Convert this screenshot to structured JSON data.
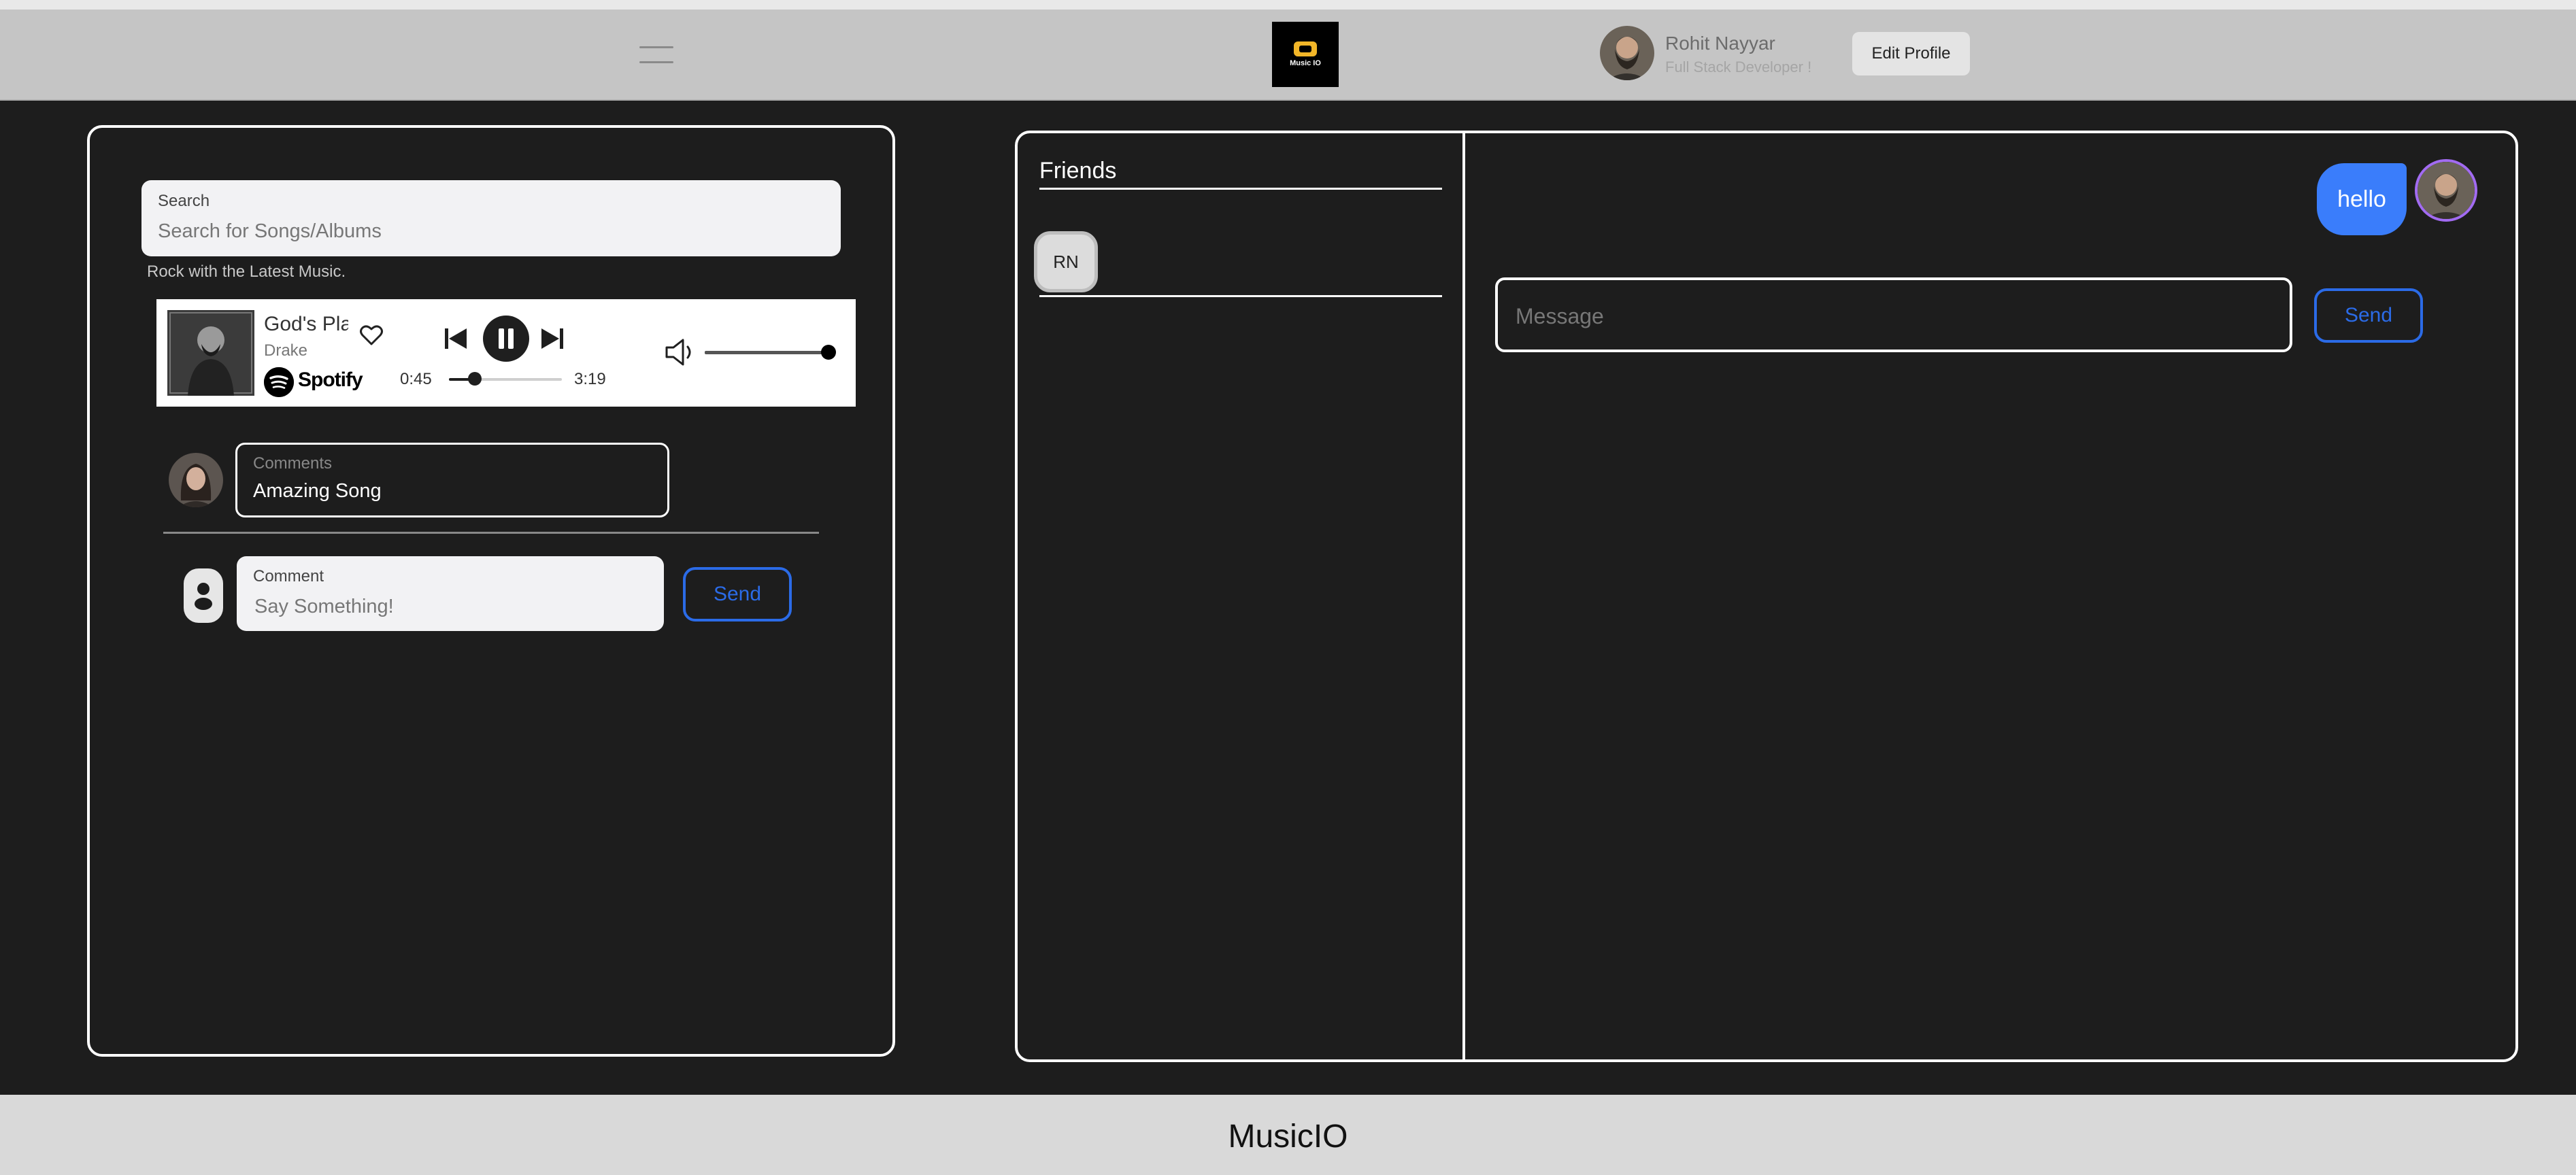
{
  "header": {
    "logo_text": "Music IO",
    "user_name": "Rohit Nayyar",
    "user_role": "Full Stack Developer !",
    "edit_profile_label": "Edit Profile"
  },
  "left": {
    "search": {
      "label": "Search",
      "placeholder": "Search for Songs/Albums"
    },
    "tagline": "Rock with the Latest Music.",
    "player": {
      "title": "God's Plan",
      "artist": "Drake",
      "brand": "Spotify",
      "current_time": "0:45",
      "total_time": "3:19",
      "progress": 0.23,
      "volume": 1.0
    },
    "comment": {
      "label": "Comments",
      "text": "Amazing Song"
    },
    "new_comment": {
      "label": "Comment",
      "placeholder": "Say Something!",
      "send_label": "Send"
    }
  },
  "right": {
    "friends_title": "Friends",
    "friends": [
      {
        "initials": "RN"
      }
    ],
    "messages": [
      {
        "text": "hello",
        "from": "me"
      }
    ],
    "message_placeholder": "Message",
    "send_label": "Send"
  },
  "footer": {
    "brand": "MusicIO"
  },
  "colors": {
    "accent": "#2b6be7",
    "bubble": "#3a7dfb",
    "background": "#1d1d1d",
    "header": "#c5c5c5"
  }
}
